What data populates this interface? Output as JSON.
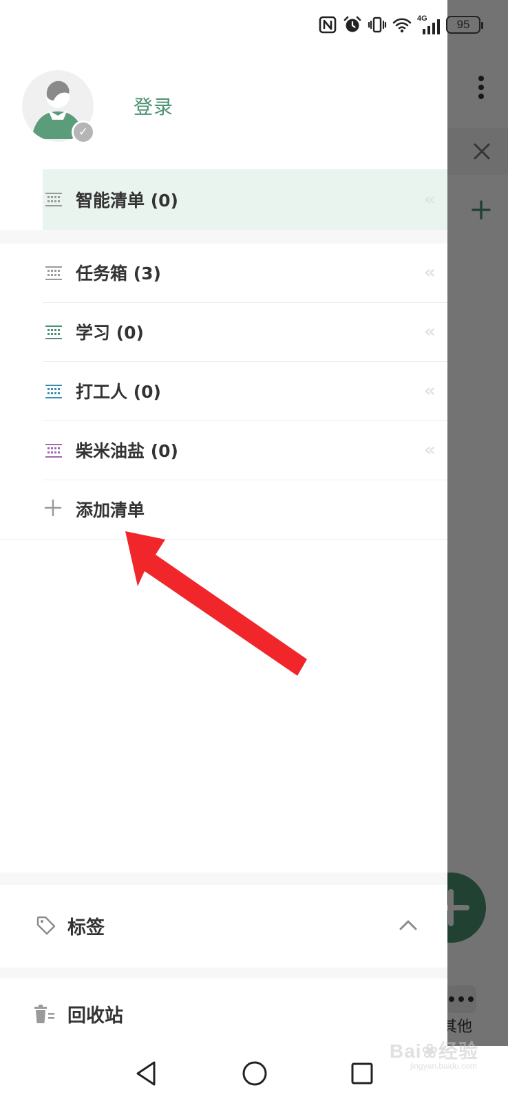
{
  "status_bar": {
    "network_label": "4G",
    "battery_level": "95"
  },
  "profile": {
    "login_label": "登录"
  },
  "smart_list": {
    "label": "智能清单 (0)",
    "icon": "list-icon",
    "icon_color": "#9a9a9a",
    "highlight_color": "#e9f4ee"
  },
  "lists": [
    {
      "label": "任务箱 (3)",
      "icon": "list-icon",
      "icon_color": "#9a9a9a"
    },
    {
      "label": "学习 (0)",
      "icon": "list-icon",
      "icon_color": "#4a9271"
    },
    {
      "label": "打工人 (0)",
      "icon": "list-icon",
      "icon_color": "#3a8fb0"
    },
    {
      "label": "柴米油盐 (0)",
      "icon": "list-icon",
      "icon_color": "#9c6ab0"
    }
  ],
  "add_list": {
    "label": "添加清单",
    "icon": "plus-icon"
  },
  "tags": {
    "label": "标签",
    "icon": "tag-icon",
    "toggle_icon": "chevron-up-icon"
  },
  "trash": {
    "label": "回收站",
    "icon": "trash-icon"
  },
  "background_app": {
    "bottom_tab_label": "其他",
    "accent_color": "#4a9271"
  },
  "nav_bar": {
    "back_icon": "back-triangle-icon",
    "home_icon": "home-circle-icon",
    "recent_icon": "recent-square-icon"
  },
  "watermark": {
    "main": "Bai",
    "tail": "经验",
    "url": "jingyan.baidu.com"
  },
  "annotation": {
    "type": "red-arrow",
    "color": "#f0262a",
    "points_to": "添加清单"
  }
}
